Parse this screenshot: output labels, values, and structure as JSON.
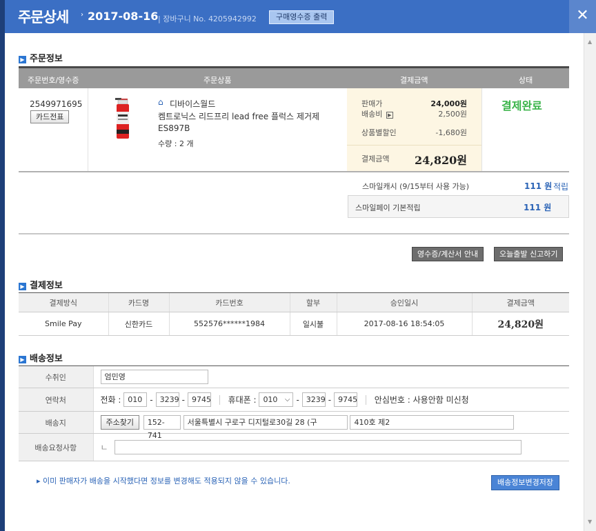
{
  "header": {
    "title": "주문상세",
    "date": "2017-08-16",
    "cart_label": "장바구니 No. 4205942992",
    "receipt_button": "구매영수증 출력",
    "close_glyph": "✕"
  },
  "order_section": {
    "title": "주문정보",
    "columns": [
      "주문번호/영수증",
      "주문상품",
      "결제금액",
      "상태"
    ],
    "order_number": "2549971695",
    "card_slip_button": "카드전표",
    "seller": "디바이스월드",
    "product_name": "켐트로닉스 리드프리 lead free 플럭스 제거제 ES897B",
    "quantity": "수량 : 2 개",
    "price_label": "판매가",
    "price_value": "24,000원",
    "shipping_label": "배송비",
    "shipping_value": "2,500원",
    "discount_label": "상품별할인",
    "discount_value": "-1,680원",
    "total_label": "결제금액",
    "total_value": "24,820원",
    "status": "결제완료",
    "smilecash_label": "스마일캐시 (9/15부터 사용 가능)",
    "smilecash_value": "111 원",
    "smilecash_suffix": "적립",
    "smilepay_label": "스마일페이 기본적립",
    "smilepay_value": "111 원",
    "receipt_guide_button": "영수증/계산서 안내",
    "today_ship_button": "오늘출발 신고하기"
  },
  "payment_section": {
    "title": "결제정보",
    "columns": [
      "결제방식",
      "카드명",
      "카드번호",
      "할부",
      "승인일시",
      "결제금액"
    ],
    "row": [
      "Smile Pay",
      "신한카드",
      "552576******1984",
      "일시불",
      "2017-08-16 18:54:05",
      "24,820원"
    ]
  },
  "shipping_section": {
    "title": "배송정보",
    "recipient_label": "수취인",
    "recipient_value": "엄민영",
    "contact_label": "연락처",
    "phone_label": "전화 :",
    "phone": [
      "010",
      "3239",
      "9745"
    ],
    "mobile_label": "휴대폰 :",
    "mobile": [
      "010",
      "3239",
      "9745"
    ],
    "safe_number": "안심번호 : 사용안함 미신청",
    "address_label": "배송지",
    "address_search_button": "주소찾기",
    "zipcode": "152-741",
    "address1": "서울특별시 구로구 디지털로30길 28 (구",
    "address2": "410호 제2",
    "request_label": "배송요청사항",
    "request_prefix": "ㄴ",
    "request_value": ""
  },
  "footer": {
    "notice": "이미 판매자가 배송을 시작했다면 정보를 변경해도 적용되지 않을 수 있습니다.",
    "save_button": "배송정보변경저장"
  },
  "colors": {
    "titlebar": "#3b6fc4",
    "status_green": "#3bb44a",
    "link_blue": "#2a63b6"
  }
}
